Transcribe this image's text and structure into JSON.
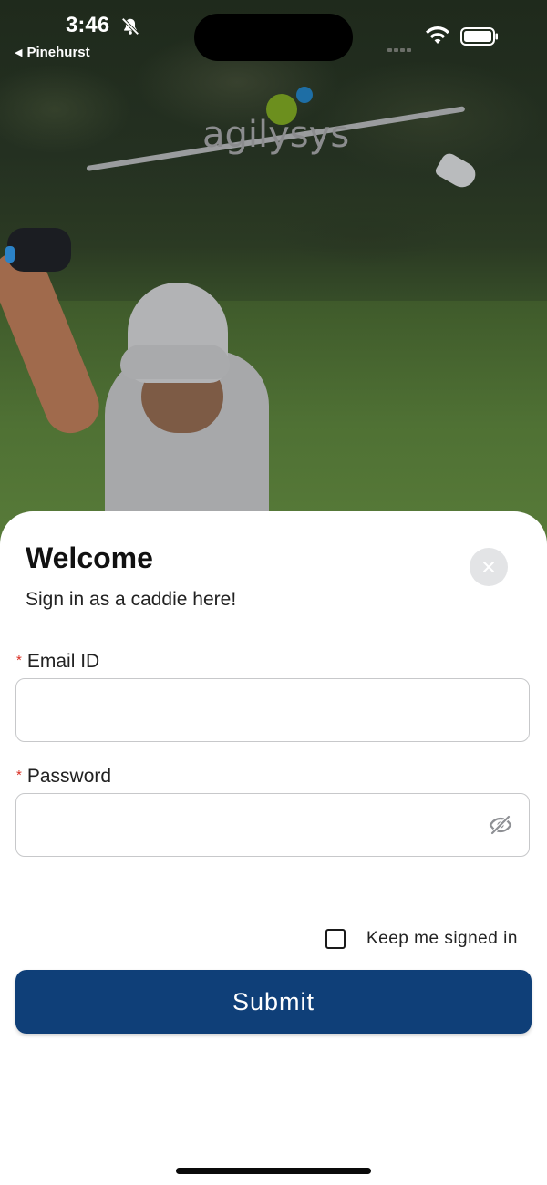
{
  "status_bar": {
    "time": "3:46",
    "back_app": "Pinehurst",
    "icons": [
      "bell-slash-icon",
      "signal-icon",
      "wifi-icon",
      "battery-icon"
    ]
  },
  "brand": {
    "logo_text": "agilysys",
    "colors": {
      "green_dot": "#6c8f1e",
      "blue_dot": "#1e6ea5"
    }
  },
  "login": {
    "title": "Welcome",
    "subtitle": "Sign in as a caddie here!",
    "close_icon": "close-icon",
    "email": {
      "label": "Email ID",
      "required_mark": "*",
      "value": "",
      "placeholder": ""
    },
    "password": {
      "label": "Password",
      "required_mark": "*",
      "value": "",
      "placeholder": "",
      "toggle_icon": "eye-off-icon"
    },
    "keep_signed_in": {
      "label": "Keep me signed in",
      "checked": false
    },
    "submit_label": "Submit",
    "accent_color": "#0f3f78"
  }
}
